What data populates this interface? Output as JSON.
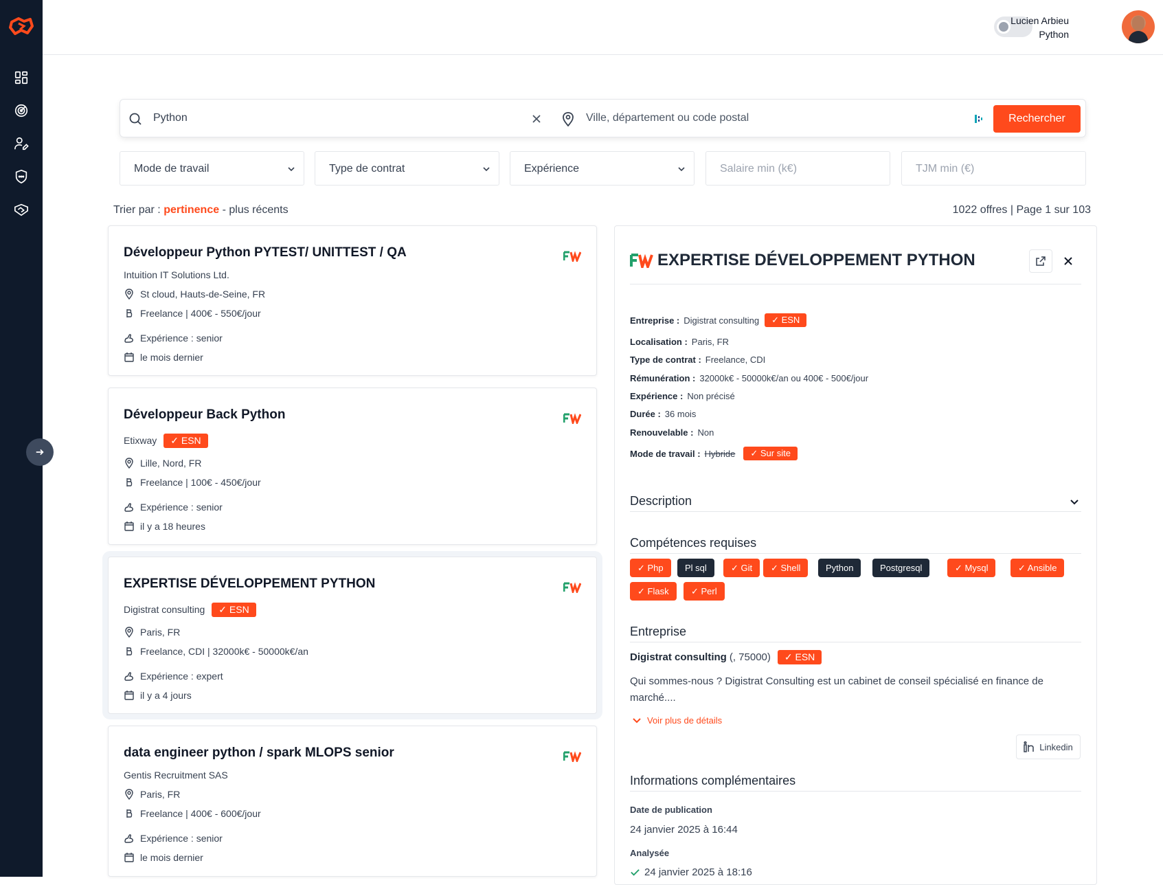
{
  "user": {
    "name": "Lucien Arbieu",
    "role": "Python"
  },
  "search": {
    "query": "Python",
    "location_placeholder": "Ville, département ou code postal",
    "button": "Rechercher"
  },
  "filters": {
    "work_mode": "Mode de travail",
    "contract": "Type de contrat",
    "experience": "Expérience",
    "salary_placeholder": "Salaire min (k€)",
    "tjm_placeholder": "TJM min (€)"
  },
  "sort": {
    "prefix": "Trier par :",
    "active": "pertinence",
    "separator": "-",
    "other": "plus récents"
  },
  "results_count": "1022 offres | Page 1 sur 103",
  "cards": [
    {
      "title": "Développeur Python PYTEST/ UNITTEST / QA",
      "company": "Intuition IT Solutions Ltd.",
      "esn": "",
      "location": "St cloud, Hauts-de-Seine, FR",
      "contract": "Freelance | 400€ - 550€/jour",
      "experience": "Expérience : senior",
      "date": "le mois dernier"
    },
    {
      "title": "Développeur Back Python",
      "company": "Etixway",
      "esn": "✓ ESN",
      "location": "Lille, Nord, FR",
      "contract": "Freelance | 100€ - 450€/jour",
      "experience": "Expérience : senior",
      "date": "il y a 18 heures"
    },
    {
      "title": "EXPERTISE DÉVELOPPEMENT PYTHON",
      "company": "Digistrat consulting",
      "esn": "✓ ESN",
      "location": "Paris, FR",
      "contract": "Freelance, CDI | 32000k€ - 50000k€/an",
      "experience": "Expérience : expert",
      "date": "il y a 4 jours"
    },
    {
      "title": "data engineer python / spark MLOPS senior",
      "company": "Gentis Recruitment SAS",
      "esn": "",
      "location": "Paris, FR",
      "contract": "Freelance | 400€ - 600€/jour",
      "experience": "Expérience : senior",
      "date": "le mois dernier"
    }
  ],
  "detail": {
    "title": "EXPERTISE DÉVELOPPEMENT PYTHON",
    "fields": {
      "entreprise_label": "Entreprise :",
      "entreprise": "Digistrat consulting",
      "esn": "✓ ESN",
      "localisation_label": "Localisation :",
      "localisation": "Paris, FR",
      "contrat_label": "Type de contrat :",
      "contrat": "Freelance, CDI",
      "remuneration_label": "Rémunération :",
      "remuneration": "32000k€ - 50000k€/an ou 400€ - 500€/jour",
      "experience_label": "Expérience :",
      "experience": "Non précisé",
      "duree_label": "Durée :",
      "duree": "36 mois",
      "renouvelable_label": "Renouvelable :",
      "renouvelable": "Non",
      "mode_label": "Mode de travail :",
      "mode_off": "Hybride",
      "mode_on": "✓ Sur site"
    },
    "description_title": "Description",
    "skills_title": "Compétences requises",
    "skills": [
      {
        "label": "✓ Php",
        "matched": true
      },
      {
        "label": "Pl sql",
        "matched": false
      },
      {
        "label": "✓ Git",
        "matched": true
      },
      {
        "label": "✓ Shell",
        "matched": true
      },
      {
        "label": "Python",
        "matched": false
      },
      {
        "label": "Postgresql",
        "matched": false
      },
      {
        "label": "✓ Mysql",
        "matched": true
      },
      {
        "label": "✓ Ansible",
        "matched": true
      },
      {
        "label": "✓ Flask",
        "matched": true
      },
      {
        "label": "✓ Perl",
        "matched": true
      }
    ],
    "company_title": "Entreprise",
    "company_name": "Digistrat consulting",
    "company_location": "(, 75000)",
    "company_desc": "Qui sommes-nous ? Digistrat Consulting est un cabinet de conseil spécialisé en finance de marché....",
    "more_link": "Voir plus de détails",
    "linkedin": "Linkedin",
    "info_title": "Informations complémentaires",
    "pub_label": "Date de publication",
    "pub_value": "24 janvier 2025 à 16:44",
    "analyzed_label": "Analysée",
    "analyzed_value": "24 janvier 2025 à 18:16"
  },
  "colors": {
    "accent": "#ff4a1c",
    "sidebar": "#0f1a2b",
    "dark_chip": "#1f2937"
  }
}
